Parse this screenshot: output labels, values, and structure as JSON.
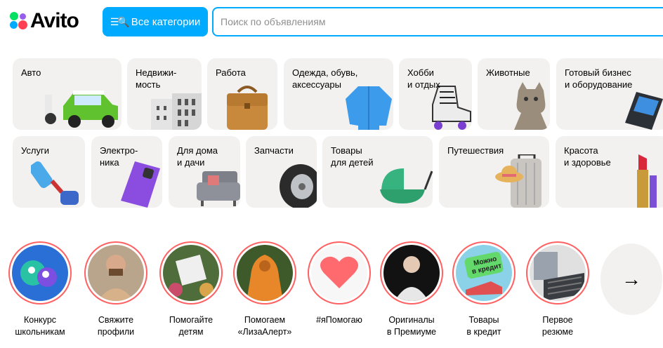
{
  "header": {
    "logo_text": "Avito",
    "categories_button": "Все категории",
    "categories_icon": "☰🔍",
    "search_placeholder": "Поиск по объявлениям"
  },
  "categories": [
    {
      "label": "Авто"
    },
    {
      "label": "Недвижи-\nмость"
    },
    {
      "label": "Работа"
    },
    {
      "label": "Одежда, обувь,\nаксессуары"
    },
    {
      "label": "Хобби\nи отдых"
    },
    {
      "label": "Животные"
    },
    {
      "label": "Готовый бизнес\nи оборудование"
    },
    {
      "label": "Услуги"
    },
    {
      "label": "Электро-\nника"
    },
    {
      "label": "Для дома\nи дачи"
    },
    {
      "label": "Запчасти"
    },
    {
      "label": "Товары\nдля детей"
    },
    {
      "label": "Путешествия"
    },
    {
      "label": "Красота\nи здоровье"
    }
  ],
  "stories": [
    {
      "caption": "Конкурс\nшкольникам"
    },
    {
      "caption": "Свяжите\nпрофили"
    },
    {
      "caption": "Помогайте\nдетям"
    },
    {
      "caption": "Помогаем\n«ЛизаАлерт»"
    },
    {
      "caption": "#яПомогаю"
    },
    {
      "caption": "Оригиналы\nв Премиуме"
    },
    {
      "caption": "Товары\nв кредит",
      "badge": "Можно\nв кредит"
    },
    {
      "caption": "Первое\nрезюме"
    }
  ],
  "next_arrow": "→",
  "colors": {
    "accent": "#00aaff",
    "tile_bg": "#f2f1f0",
    "story_ring": "#ff6163"
  }
}
